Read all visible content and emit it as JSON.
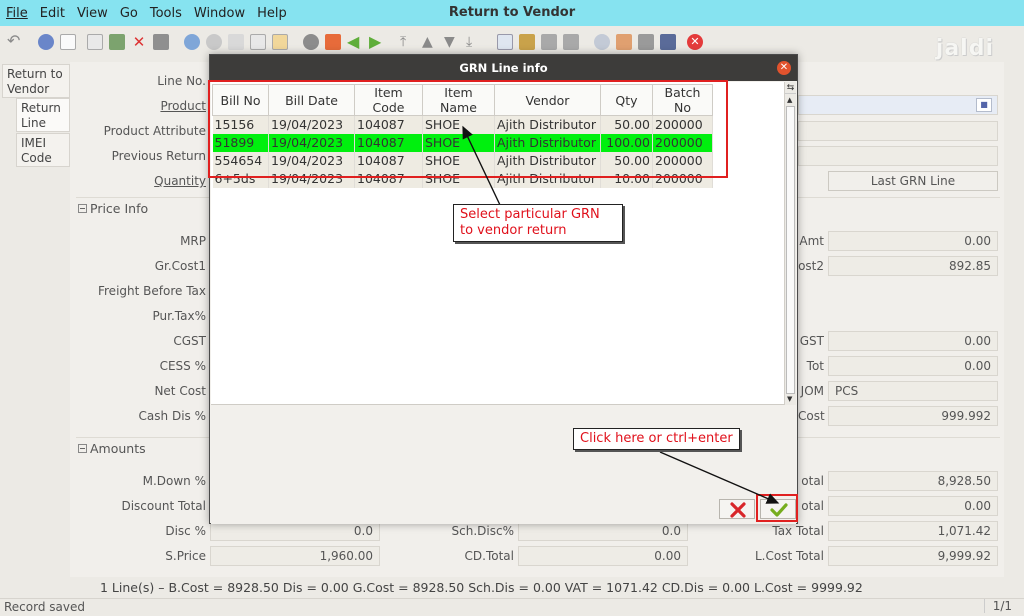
{
  "window_title": "Return to Vendor",
  "menu": [
    "File",
    "Edit",
    "View",
    "Go",
    "Tools",
    "Window",
    "Help"
  ],
  "logo_text": "jaldi",
  "left_tabs": [
    "Return to Vendor",
    "Return Line",
    "IMEI Code"
  ],
  "form": {
    "labels": {
      "line_no": "Line No.",
      "product": "Product",
      "product_attribute": "Product Attribute",
      "previous_return": "Previous Return",
      "quantity": "Quantity"
    },
    "last_grn_button": "Last GRN Line",
    "price_info": {
      "header": "Price Info",
      "labels": [
        "MRP",
        "Gr.Cost1",
        "Freight Before Tax",
        "Pur.Tax%",
        "CGST",
        "CESS %",
        "Net Cost",
        "Cash Dis %"
      ],
      "right_labels": [
        "Amt",
        "ost2",
        "GST",
        "Tot",
        "JOM",
        "Cost"
      ],
      "right_values": [
        "0.00",
        "892.85",
        "0.00",
        "0.00",
        "PCS",
        "999.992"
      ]
    },
    "amounts": {
      "header": "Amounts",
      "labels": [
        "M.Down %",
        "Discount Total",
        "Disc %",
        "S.Price"
      ],
      "disc_value": "0.0",
      "sprice_value": "1,960.00",
      "mid_labels": [
        "Sch.Disc%",
        "CD.Total"
      ],
      "mid_values": [
        "0.0",
        "0.00"
      ],
      "right_labels": [
        "otal",
        "otal",
        "Tax Total",
        "L.Cost Total"
      ],
      "right_values": [
        "8,928.50",
        "0.00",
        "1,071.42",
        "9,999.92"
      ]
    }
  },
  "totals_bar": "1 Line(s) –   B.Cost = 8928.50   Dis = 0.00   G.Cost = 8928.50   Sch.Dis = 0.00   VAT = 1071.42   CD.Dis = 0.00   L.Cost = 9999.92",
  "status": {
    "text": "Record saved",
    "page": "1/1"
  },
  "dialog": {
    "title": "GRN Line info",
    "columns": [
      "Bill No",
      "Bill Date",
      "Item Code",
      "Item Name",
      "Vendor",
      "Qty",
      "Batch No"
    ],
    "rows": [
      [
        "15156",
        "19/04/2023",
        "104087",
        "SHOE",
        "Ajith Distributor",
        "50.00",
        "200000"
      ],
      [
        "51899",
        "19/04/2023",
        "104087",
        "SHOE",
        "Ajith Distributor",
        "100.00",
        "200000"
      ],
      [
        "554654",
        "19/04/2023",
        "104087",
        "SHOE",
        "Ajith Distributor",
        "50.00",
        "200000"
      ],
      [
        "6+5ds",
        "19/04/2023",
        "104087",
        "SHOE",
        "Ajith Distributor",
        "10.00",
        "200000"
      ]
    ],
    "selected_row": 1,
    "callout_select": "Select particular GRN to vendor return",
    "callout_ok": "Click here or ctrl+enter",
    "selected_color": "#00f00e",
    "annotation_color": "#e02020"
  }
}
